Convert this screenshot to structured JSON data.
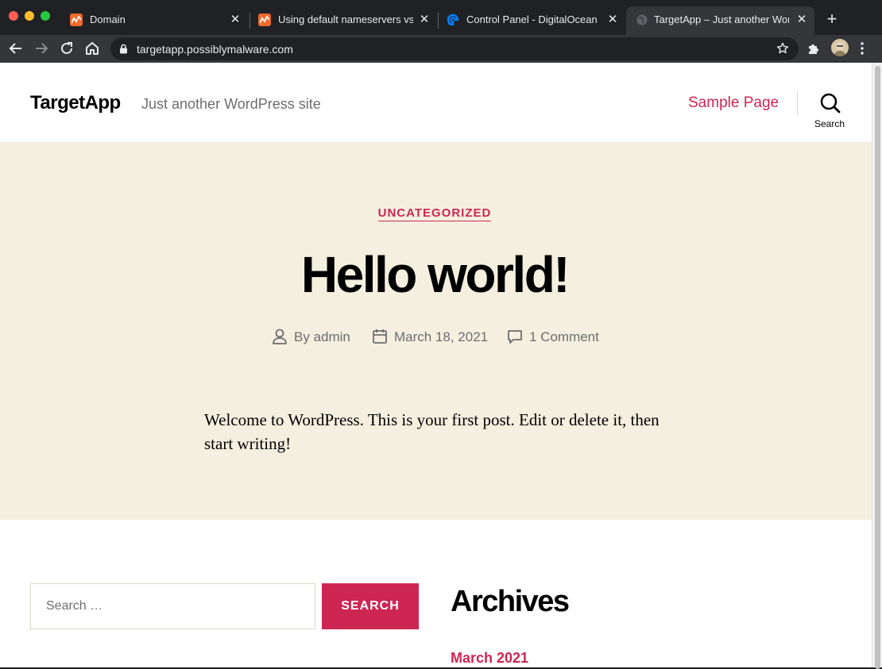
{
  "browser": {
    "tabs": [
      {
        "title": "Domain",
        "favicon": "orange-chart-icon"
      },
      {
        "title": "Using default nameservers vs ",
        "favicon": "orange-chart-icon"
      },
      {
        "title": "Control Panel - DigitalOcean",
        "favicon": "digitalocean-icon"
      },
      {
        "title": "TargetApp – Just another Word",
        "favicon": "globe-icon",
        "active": true
      }
    ],
    "url": "targetapp.possiblymalware.com",
    "colors": {
      "chrome_dark": "#202124",
      "chrome_toolbar": "#35363a"
    }
  },
  "site": {
    "title": "TargetApp",
    "description": "Just another WordPress site",
    "nav": {
      "sample_page": "Sample Page"
    },
    "search_label": "Search"
  },
  "post": {
    "category": "UNCATEGORIZED",
    "title": "Hello world!",
    "meta": {
      "author": "By admin",
      "date": "March 18, 2021",
      "comments": "1 Comment"
    },
    "content": "Welcome to WordPress. This is your first post. Edit or delete it, then start writing!"
  },
  "widgets": {
    "search": {
      "placeholder": "Search …",
      "button": "SEARCH"
    },
    "archives": {
      "title": "Archives",
      "items": [
        "March 2021"
      ]
    }
  },
  "colors": {
    "accent": "#cd2653",
    "hero_bg": "#f5efe0",
    "muted": "#6d6d6d"
  }
}
